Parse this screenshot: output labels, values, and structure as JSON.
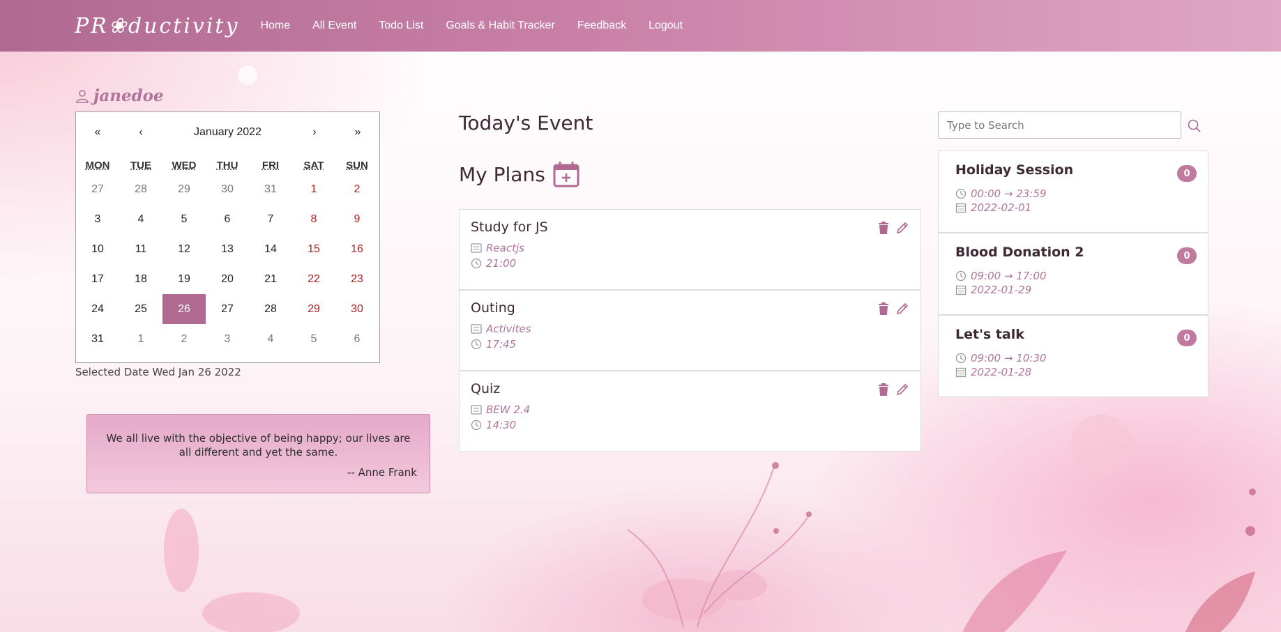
{
  "colors": {
    "accent": "#b06a91",
    "navbar": "#c980a6",
    "weekend": "#b02020",
    "meta": "#b0749a"
  },
  "nav": {
    "brand": "PR❀ductivity",
    "links": [
      "Home",
      "All Event",
      "Todo List",
      "Goals & Habit Tracker",
      "Feedback",
      "Logout"
    ]
  },
  "user": {
    "name": "janedoe",
    "icon": "user-icon"
  },
  "calendar": {
    "nav": {
      "prev_year": "«",
      "prev_month": "‹",
      "next_month": "›",
      "next_year": "»"
    },
    "month_label": "January 2022",
    "weekdays": [
      "MON",
      "TUE",
      "WED",
      "THU",
      "FRI",
      "SAT",
      "SUN"
    ],
    "weeks": [
      [
        "27",
        "28",
        "29",
        "30",
        "31",
        "1",
        "2"
      ],
      [
        "3",
        "4",
        "5",
        "6",
        "7",
        "8",
        "9"
      ],
      [
        "10",
        "11",
        "12",
        "13",
        "14",
        "15",
        "16"
      ],
      [
        "17",
        "18",
        "19",
        "20",
        "21",
        "22",
        "23"
      ],
      [
        "24",
        "25",
        "26",
        "27",
        "28",
        "29",
        "30"
      ],
      [
        "31",
        "1",
        "2",
        "3",
        "4",
        "5",
        "6"
      ]
    ],
    "selected_day": "26",
    "selected_label": "Selected Date Wed Jan 26 2022"
  },
  "quote": {
    "text": "We all live with the objective of being happy; our lives are all different and yet the same.",
    "author": "-- Anne Frank"
  },
  "today_title": "Today's Event",
  "plans_title": "My Plans",
  "plans": [
    {
      "title": "Study for JS",
      "category": "Reactjs",
      "time": "21:00"
    },
    {
      "title": "Outing",
      "category": "Activites",
      "time": "17:45"
    },
    {
      "title": "Quiz",
      "category": "BEW 2.4",
      "time": "14:30"
    }
  ],
  "search": {
    "placeholder": "Type to Search"
  },
  "events": [
    {
      "title": "Holiday Session",
      "time": "00:00 → 23:59",
      "date": "2022-02-01",
      "count": "0"
    },
    {
      "title": "Blood Donation 2",
      "time": "09:00 → 17:00",
      "date": "2022-01-29",
      "count": "0"
    },
    {
      "title": "Let's talk",
      "time": "09:00 → 10:30",
      "date": "2022-01-28",
      "count": "0"
    }
  ]
}
